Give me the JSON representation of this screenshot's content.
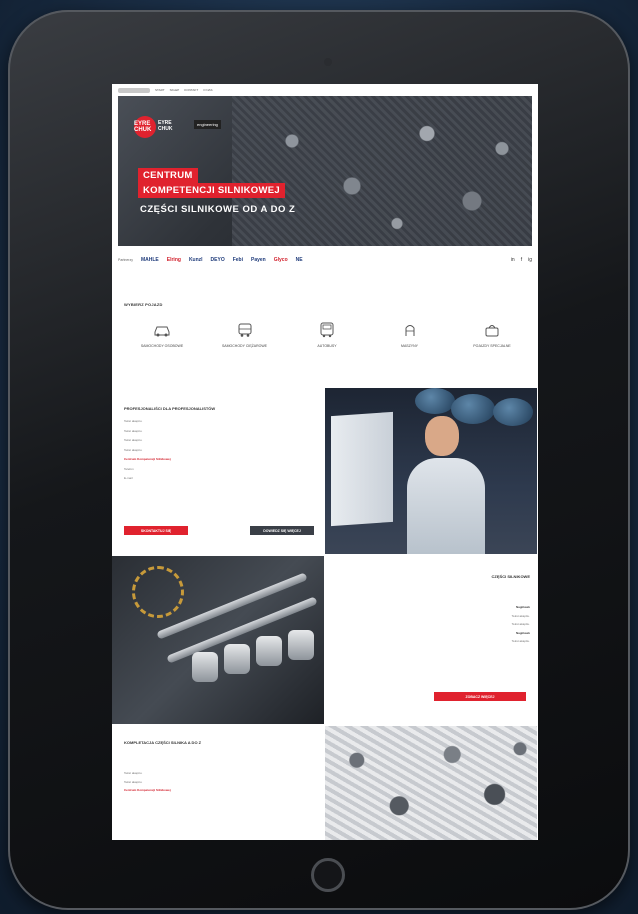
{
  "nav": {
    "items": [
      "Start",
      "Sklep",
      "Kontakt",
      "O nas"
    ]
  },
  "hero": {
    "logo": "EYRE CHUK",
    "brand_line1": "EYRE",
    "brand_line2": "CHUK",
    "badge": "engineering",
    "line1": "CENTRUM",
    "line2": "KOMPETENCJI SILNIKOWEJ",
    "subtitle": "CZĘŚCI SILNIKOWE OD A DO Z"
  },
  "brands": {
    "label": "Partnerzy",
    "items": [
      "MAHLE",
      "Elring",
      "Kunzl",
      "DEYO",
      "Febi",
      "Payen",
      "Glyco",
      "NE"
    ],
    "social": [
      "in",
      "f",
      "ig"
    ]
  },
  "categories": {
    "title": "Wybierz pojazd",
    "items": [
      {
        "label": "Samochody osobowe",
        "icon": "car-icon"
      },
      {
        "label": "Samochody ciężarowe",
        "icon": "truck-icon"
      },
      {
        "label": "Autobusy",
        "icon": "bus-icon"
      },
      {
        "label": "Maszyny",
        "icon": "machine-icon"
      },
      {
        "label": "Pojazdy specjalne",
        "icon": "bag-icon"
      }
    ]
  },
  "professionals": {
    "title": "PROFESJONALIŚCI DLA PROFESJONALISTÓW",
    "p1": "Tekst akapitu.",
    "p2": "Tekst akapitu.",
    "p3": "Tekst akapitu.",
    "p4": "Tekst akapitu.",
    "link": "Centrum Kompetencji Silnikowej",
    "phone": "Telefon",
    "email": "E-mail",
    "btn_primary": "Skontaktuj się",
    "btn_secondary": "Dowiedz się więcej"
  },
  "engine": {
    "title": "CZĘŚCI SILNIKOWE",
    "p1_title": "Nagłówek",
    "p1": "Tekst akapitu.",
    "p2": "Tekst akapitu.",
    "p3_title": "Nagłówek",
    "p3": "Tekst akapitu.",
    "btn": "Zobacz więcej"
  },
  "kompletacja": {
    "title": "KOMPLETACJA CZĘŚCI SILNIKA A DO Z",
    "p1": "Tekst akapitu.",
    "p2": "Tekst akapitu.",
    "link": "Centrum Kompetencji Silnikowej"
  },
  "colors": {
    "accent": "#e0222e",
    "dark": "#3a3f47",
    "text": "#333333"
  }
}
